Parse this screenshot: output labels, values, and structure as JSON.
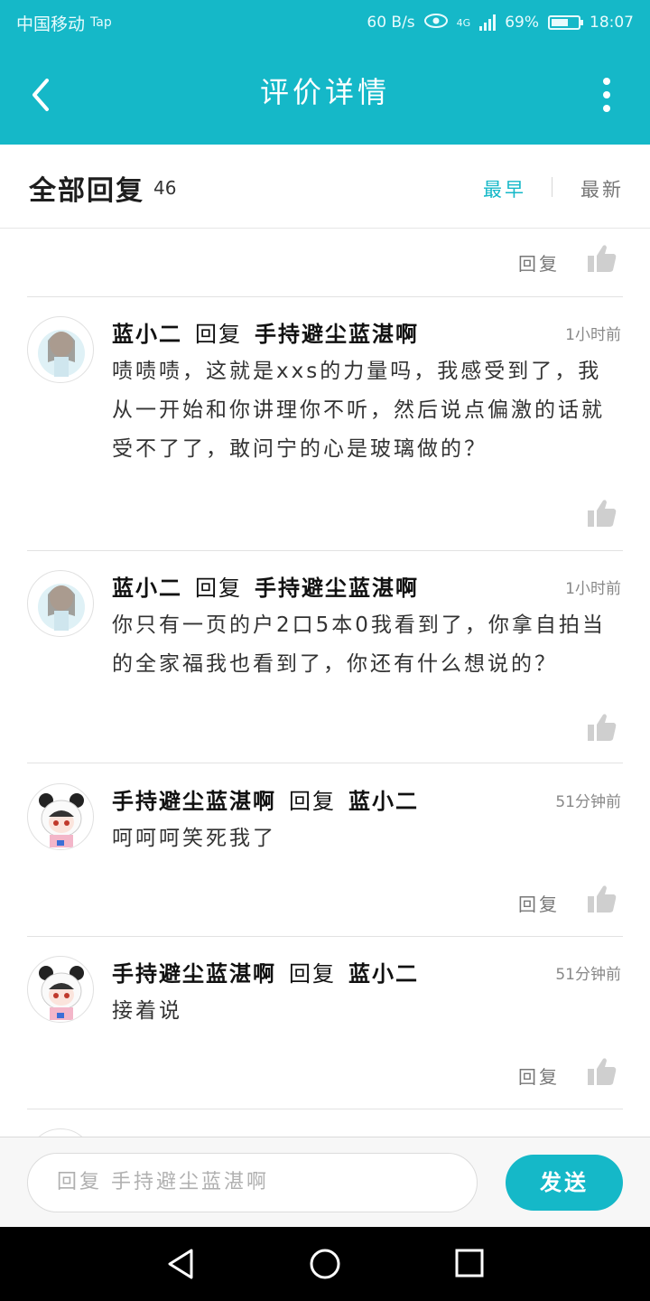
{
  "status_bar": {
    "carrier": "中国移动",
    "carrier_badge": "Tap",
    "net_speed": "60 B/s",
    "network": "4G",
    "battery": "69%",
    "battery_level": 0.69,
    "time": "18:07"
  },
  "nav": {
    "title": "评价详情"
  },
  "replies_header": {
    "title": "全部回复",
    "count": "46",
    "sort_early": "最早",
    "sort_new": "最新"
  },
  "top_partial": {
    "reply_label": "回复"
  },
  "comments": [
    {
      "author": "蓝小二",
      "reply_word": "回复",
      "target": "手持避尘蓝湛啊",
      "time": "1小时前",
      "text": "啧啧啧，这就是xxs的力量吗，我感受到了，我从一开始和你讲理你不听，然后说点偏激的话就受不了了，敢问宁的心是玻璃做的？"
    },
    {
      "author": "蓝小二",
      "reply_word": "回复",
      "target": "手持避尘蓝湛啊",
      "time": "1小时前",
      "text": "你只有一页的户2口5本0我看到了，你拿自拍当的全家福我也看到了，你还有什么想说的？"
    },
    {
      "author": "手持避尘蓝湛啊",
      "reply_word": "回复",
      "target": "蓝小二",
      "time": "51分钟前",
      "text": "呵呵呵笑死我了",
      "reply_label": "回复"
    },
    {
      "author": "手持避尘蓝湛啊",
      "reply_word": "回复",
      "target": "蓝小二",
      "time": "51分钟前",
      "text": "接着说",
      "reply_label": "回复"
    }
  ],
  "compose": {
    "placeholder": "回复 手持避尘蓝湛啊",
    "send_label": "发送"
  },
  "colors": {
    "accent": "#15b8c8",
    "like_gray": "#cfcfcf"
  }
}
